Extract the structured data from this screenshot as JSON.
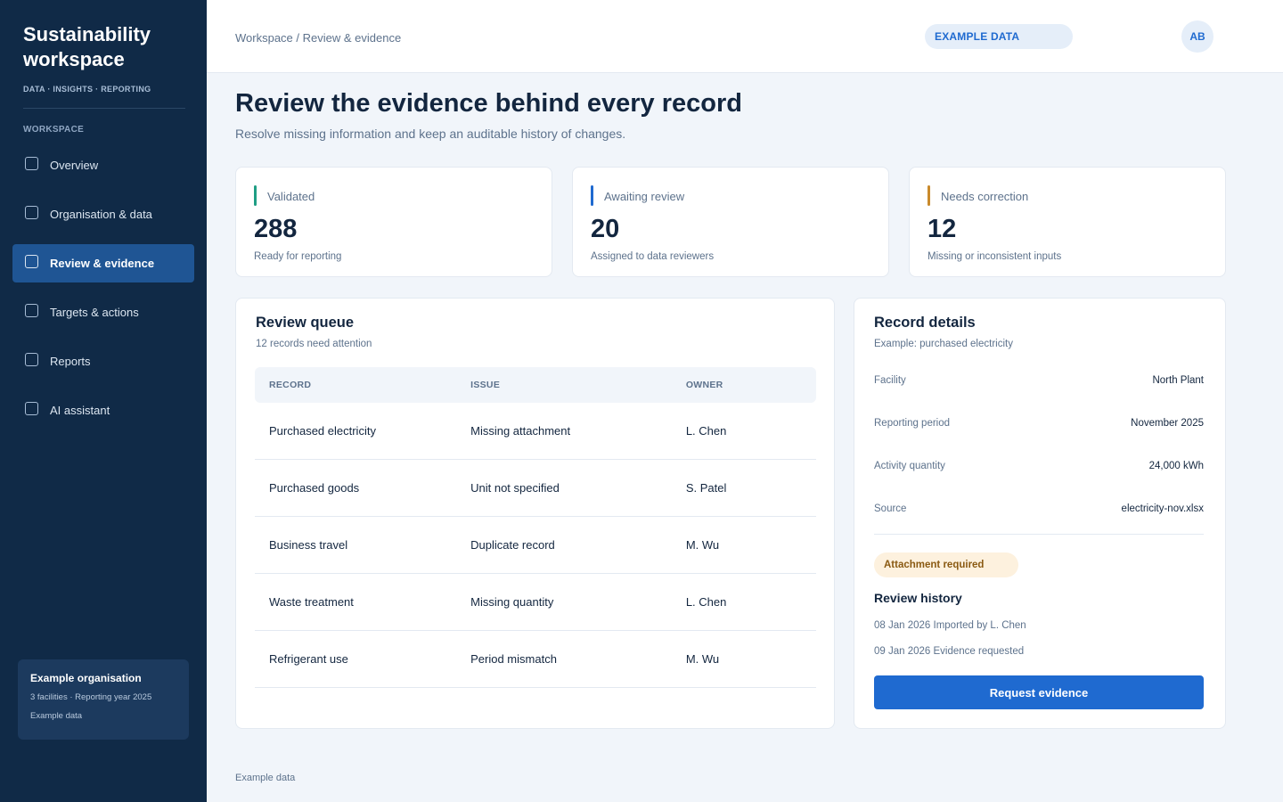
{
  "sidebar": {
    "brand_title": "Sustainability workspace",
    "brand_subtitle": "DATA · INSIGHTS · REPORTING",
    "section_label": "WORKSPACE",
    "items": [
      {
        "label": "Overview",
        "active": false
      },
      {
        "label": "Organisation & data",
        "active": false
      },
      {
        "label": "Review & evidence",
        "active": true
      },
      {
        "label": "Targets & actions",
        "active": false
      },
      {
        "label": "Reports",
        "active": false
      },
      {
        "label": "AI assistant",
        "active": false
      }
    ],
    "org_card": {
      "name": "Example organisation",
      "meta": "3 facilities · Reporting year 2025",
      "note": "Example data"
    }
  },
  "header": {
    "breadcrumb": "Workspace / Review & evidence",
    "badge": "EXAMPLE DATA",
    "avatar_initials": "AB"
  },
  "page": {
    "title": "Review the evidence behind every record",
    "subtitle": "Resolve missing information and keep an auditable history of changes."
  },
  "stats": [
    {
      "label": "Validated",
      "value": "288",
      "desc": "Ready for reporting",
      "color": "#1f9e84"
    },
    {
      "label": "Awaiting review",
      "value": "20",
      "desc": "Assigned to data reviewers",
      "color": "#1f6ad0"
    },
    {
      "label": "Needs correction",
      "value": "12",
      "desc": "Missing or inconsistent inputs",
      "color": "#c98a2c"
    }
  ],
  "queue": {
    "title": "Review queue",
    "subtitle": "12 records need attention",
    "columns": [
      "RECORD",
      "ISSUE",
      "OWNER"
    ],
    "rows": [
      {
        "record": "Purchased electricity",
        "issue": "Missing attachment",
        "owner": "L. Chen"
      },
      {
        "record": "Purchased goods",
        "issue": "Unit not specified",
        "owner": "S. Patel"
      },
      {
        "record": "Business travel",
        "issue": "Duplicate record",
        "owner": "M. Wu"
      },
      {
        "record": "Waste treatment",
        "issue": "Missing quantity",
        "owner": "L. Chen"
      },
      {
        "record": "Refrigerant use",
        "issue": "Period mismatch",
        "owner": "M. Wu"
      }
    ]
  },
  "details": {
    "title": "Record details",
    "subtitle": "Example: purchased electricity",
    "fields": [
      {
        "key": "Facility",
        "value": "North Plant"
      },
      {
        "key": "Reporting period",
        "value": "November 2025"
      },
      {
        "key": "Activity quantity",
        "value": "24,000 kWh"
      },
      {
        "key": "Source",
        "value": "electricity-nov.xlsx"
      }
    ],
    "status_badge": "Attachment required",
    "history_title": "Review history",
    "history": [
      "08 Jan 2026 Imported by L. Chen",
      "09 Jan 2026 Evidence requested"
    ],
    "action_label": "Request evidence"
  },
  "footer_note": "Example data"
}
